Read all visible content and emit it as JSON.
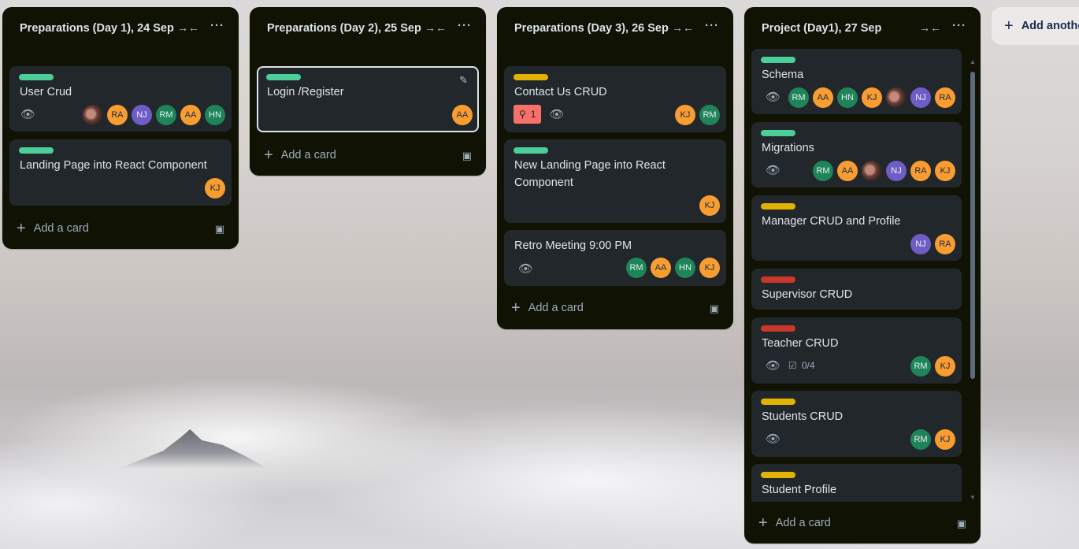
{
  "lists": [
    {
      "title": "Preparations (Day 1), 24 Sep",
      "add_card_label": "Add a card",
      "cards": [
        {
          "title": "User Crud",
          "label_color": "#4bce97",
          "members": [
            "photo",
            "RA",
            "NJ",
            "RM",
            "AA",
            "HN"
          ]
        },
        {
          "title": "Landing Page into React Component",
          "label_color": "#4bce97",
          "members": [
            "KJ"
          ]
        }
      ]
    },
    {
      "title": "Preparations (Day 2), 25 Sep",
      "add_card_label": "Add a card",
      "cards": [
        {
          "title": "Login /Register",
          "label_color": "#4bce97",
          "members": [
            "AA"
          ]
        }
      ]
    },
    {
      "title": "Preparations (Day 3), 26 Sep",
      "add_card_label": "Add a card",
      "cards": [
        {
          "title": "Contact Us CRUD",
          "label_color": "#e2b203",
          "badge_count": "1",
          "members": [
            "KJ",
            "RM"
          ]
        },
        {
          "title": "New Landing Page into React Component",
          "label_color": "#4bce97",
          "members": [
            "KJ"
          ]
        },
        {
          "title": "Retro Meeting 9:00 PM",
          "members": [
            "RM",
            "AA",
            "HN",
            "KJ"
          ]
        }
      ]
    },
    {
      "title": "Project (Day1), 27 Sep",
      "add_card_label": "Add a card",
      "cards": [
        {
          "title": "Schema",
          "label_color": "#4bce97",
          "members": [
            "RM",
            "AA",
            "HN",
            "KJ",
            "photo",
            "NJ",
            "RA"
          ]
        },
        {
          "title": "Migrations",
          "label_color": "#4bce97",
          "members": [
            "RM",
            "AA",
            "photo",
            "NJ",
            "RA",
            "KJ"
          ]
        },
        {
          "title": "Manager CRUD and Profile",
          "label_color": "#e2b203",
          "members": [
            "NJ",
            "RA"
          ]
        },
        {
          "title": "Supervisor CRUD",
          "label_color": "#c9372c",
          "members": []
        },
        {
          "title": "Teacher CRUD",
          "label_color": "#c9372c",
          "checklist": "0/4",
          "members": [
            "RM",
            "KJ"
          ]
        },
        {
          "title": "Students CRUD",
          "label_color": "#e2b203",
          "members": [
            "RM",
            "KJ"
          ]
        },
        {
          "title": "Student Profile",
          "label_color": "#e2b203",
          "members": []
        }
      ]
    }
  ],
  "add_list_label": "Add another list",
  "avatar_colors": {
    "orange": "#f99d31",
    "green": "#1f845a",
    "purple": "#6e5dc6"
  }
}
